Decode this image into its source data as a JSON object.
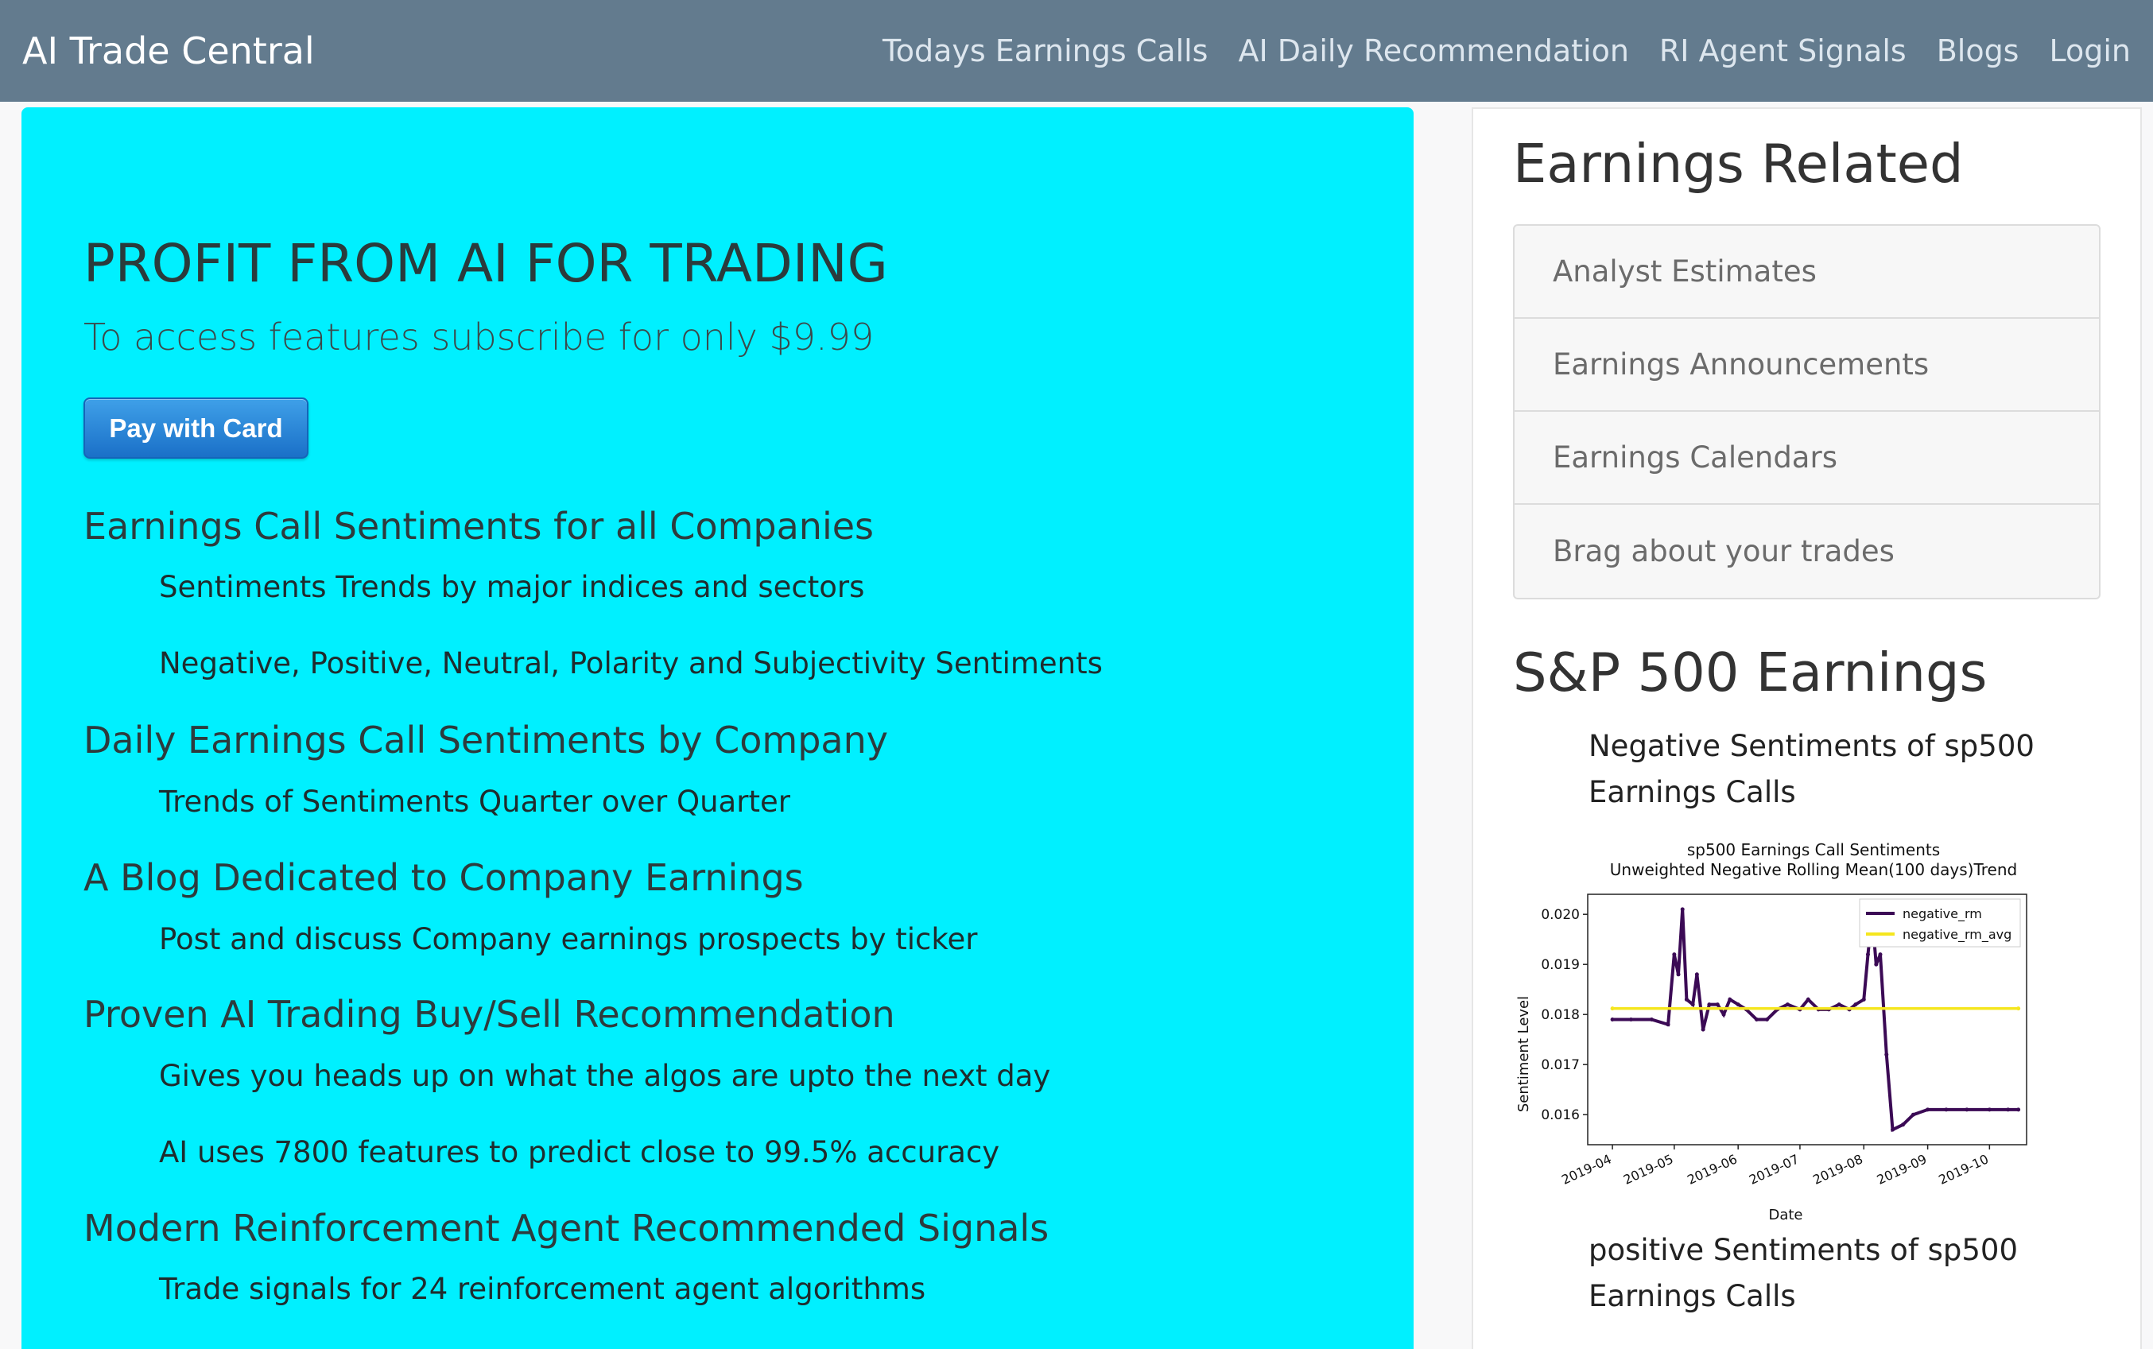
{
  "nav": {
    "brand": "AI Trade Central",
    "links": [
      "Todays Earnings Calls",
      "AI Daily Recommendation",
      "RI Agent Signals",
      "Blogs",
      "Login"
    ]
  },
  "hero": {
    "title": "PROFIT FROM AI FOR TRADING",
    "lead": "To access features subscribe for only $9.99",
    "pay_button": "Pay with Card"
  },
  "features": [
    {
      "heading": "Earnings Call Sentiments for all Companies",
      "items": [
        "Sentiments Trends by major indices and sectors",
        "Negative, Positive, Neutral, Polarity and Subjectivity Sentiments"
      ]
    },
    {
      "heading": "Daily Earnings Call Sentiments by Company",
      "items": [
        "Trends of Sentiments Quarter over Quarter"
      ]
    },
    {
      "heading": "A Blog Dedicated to Company Earnings",
      "items": [
        "Post and discuss Company earnings prospects by ticker"
      ]
    },
    {
      "heading": "Proven AI Trading Buy/Sell Recommendation",
      "items": [
        "Gives you heads up on what the algos are upto the next day",
        "AI uses 7800 features to predict close to 99.5% accuracy"
      ]
    },
    {
      "heading": "Modern Reinforcement Agent Recommended Signals",
      "items": [
        "Trade signals for 24 reinforcement agent algorithms"
      ]
    }
  ],
  "sidebar": {
    "earnings_heading": "Earnings Related",
    "links": [
      "Analyst Estimates",
      "Earnings Announcements",
      "Earnings Calendars",
      "Brag about your trades"
    ],
    "sp_heading": "S&P 500 Earnings",
    "neg_caption": "Negative Sentiments of sp500 Earnings Calls",
    "pos_caption": "positive Sentiments of sp500 Earnings Calls"
  },
  "chart_data": {
    "type": "line",
    "title": "sp500 Earnings Call Sentiments",
    "subtitle": "Unweighted Negative Rolling Mean(100 days)Trend",
    "xlabel": "Date",
    "ylabel": "Sentiment Level",
    "x_ticks": [
      "2019-04",
      "2019-05",
      "2019-06",
      "2019-07",
      "2019-08",
      "2019-09",
      "2019-10"
    ],
    "y_ticks": [
      "0.016",
      "0.017",
      "0.018",
      "0.019",
      "0.020"
    ],
    "ylim": [
      0.0154,
      0.0204
    ],
    "legend": "top-right",
    "series": [
      {
        "name": "negative_rm",
        "color": "#3b0a55",
        "x": [
          "2019-04-01",
          "2019-04-10",
          "2019-04-20",
          "2019-04-28",
          "2019-05-01",
          "2019-05-03",
          "2019-05-05",
          "2019-05-07",
          "2019-05-10",
          "2019-05-12",
          "2019-05-15",
          "2019-05-18",
          "2019-05-22",
          "2019-05-25",
          "2019-05-28",
          "2019-06-01",
          "2019-06-05",
          "2019-06-10",
          "2019-06-15",
          "2019-06-20",
          "2019-06-25",
          "2019-07-01",
          "2019-07-05",
          "2019-07-10",
          "2019-07-15",
          "2019-07-20",
          "2019-07-25",
          "2019-07-28",
          "2019-08-01",
          "2019-08-03",
          "2019-08-05",
          "2019-08-07",
          "2019-08-09",
          "2019-08-12",
          "2019-08-15",
          "2019-08-20",
          "2019-08-25",
          "2019-09-01",
          "2019-09-10",
          "2019-09-20",
          "2019-10-01",
          "2019-10-10",
          "2019-10-15"
        ],
        "y": [
          0.0179,
          0.0179,
          0.0179,
          0.0178,
          0.0192,
          0.0188,
          0.0201,
          0.0183,
          0.0182,
          0.0188,
          0.0177,
          0.0182,
          0.0182,
          0.018,
          0.0183,
          0.0182,
          0.0181,
          0.0179,
          0.0179,
          0.0181,
          0.0182,
          0.0181,
          0.0183,
          0.0181,
          0.0181,
          0.0182,
          0.0181,
          0.0182,
          0.0183,
          0.0192,
          0.02,
          0.019,
          0.0192,
          0.0172,
          0.0157,
          0.0158,
          0.016,
          0.0161,
          0.0161,
          0.0161,
          0.0161,
          0.0161,
          0.0161
        ]
      },
      {
        "name": "negative_rm_avg",
        "color": "#f5e61e",
        "x": [
          "2019-04-01",
          "2019-10-15"
        ],
        "y": [
          0.01812,
          0.01812
        ]
      }
    ]
  }
}
